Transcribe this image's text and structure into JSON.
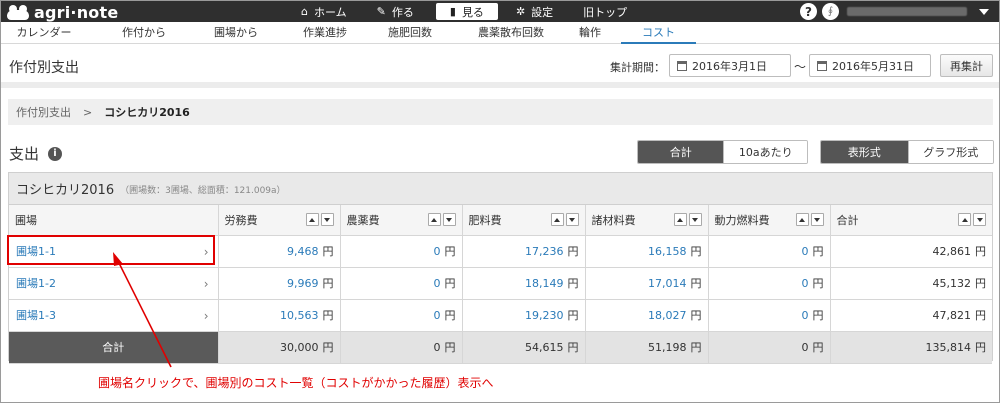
{
  "app": {
    "name": "agri·note"
  },
  "topnav": [
    {
      "label": "ホーム",
      "icon": "home-icon"
    },
    {
      "label": "作る",
      "icon": "pen-icon"
    },
    {
      "label": "見る",
      "icon": "book-icon"
    },
    {
      "label": "設定",
      "icon": "gear-icon"
    },
    {
      "label": "旧トップ",
      "icon": ""
    }
  ],
  "subnav": [
    "カレンダー",
    "作付から",
    "圃場から",
    "作業進捗",
    "施肥回数",
    "農薬散布回数",
    "輪作",
    "コスト"
  ],
  "header": {
    "title": "作付別支出",
    "period_label": "集計期間：",
    "start_date": "2016年3月1日",
    "end_date": "2016年5月31日",
    "tilde": "〜",
    "recalc": "再集計"
  },
  "breadcrumb": {
    "parent": "作付別支出",
    "sep": ">",
    "current": "コシヒカリ2016"
  },
  "section": {
    "title": "支出",
    "view_mode": [
      "合計",
      "10aあたり"
    ],
    "format_mode": [
      "表形式",
      "グラフ形式"
    ]
  },
  "panel": {
    "title": "コシヒカリ2016",
    "subtitle": "（圃場数：3圃場、総面積：121.009a）"
  },
  "table": {
    "columns": [
      "圃場",
      "労務費",
      "農薬費",
      "肥料費",
      "諸材料費",
      "動力燃料費",
      "合計"
    ],
    "unit": "円",
    "rows": [
      {
        "field": "圃場1-1",
        "values": [
          "9,468",
          "0",
          "17,236",
          "16,158",
          "0",
          "42,861"
        ]
      },
      {
        "field": "圃場1-2",
        "values": [
          "9,969",
          "0",
          "18,149",
          "17,014",
          "0",
          "45,132"
        ]
      },
      {
        "field": "圃場1-3",
        "values": [
          "10,563",
          "0",
          "19,230",
          "18,027",
          "0",
          "47,821"
        ]
      }
    ],
    "total": {
      "label": "合計",
      "values": [
        "30,000",
        "0",
        "54,615",
        "51,198",
        "0",
        "135,814"
      ]
    }
  },
  "annotation": "圃場名クリックで、圃場別のコスト一覧（コストがかかった履歴）表示へ",
  "colors": {
    "link": "#2b7bb9",
    "annotation": "#e00000",
    "topbar": "#2f2f2f"
  }
}
